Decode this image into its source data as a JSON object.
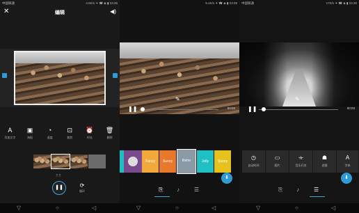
{
  "panels": [
    {
      "status": {
        "carrier": "中国联通",
        "right": "4.6K/s ✦ ☎ ◈ ▮ 23:26"
      },
      "header": {
        "title": "编辑"
      },
      "tools": [
        {
          "icon": "text-icon",
          "glyph": "A",
          "label": "添加文字"
        },
        {
          "icon": "image-icon",
          "glyph": "▣",
          "label": "海报"
        },
        {
          "icon": "speed-icon",
          "glyph": "◔",
          "label": "速度"
        },
        {
          "icon": "crop-icon",
          "glyph": "⊡",
          "label": "裁剪"
        },
        {
          "icon": "alarm-icon",
          "glyph": "⏰",
          "label": "时长"
        },
        {
          "icon": "delete-icon",
          "glyph": "🗑",
          "label": "删除"
        }
      ],
      "repeat": {
        "label": "循环"
      }
    },
    {
      "status": {
        "carrier": "",
        "right": "5.4K/s ✦ ☎ ◈ ▮ 23:29"
      },
      "player": {
        "time": "00:03"
      },
      "tiles": [
        "",
        "Fancy",
        "Sunny",
        "Retro",
        "Jolly",
        "Sunny"
      ]
    },
    {
      "status": {
        "carrier": "中国联通",
        "right": "17K/s ✦ ☎ ◈ ▮ 23:30"
      },
      "player": {
        "time": "00:03"
      },
      "options": [
        {
          "icon": "clock-icon",
          "glyph": "◷",
          "label": "自动时间"
        },
        {
          "icon": "picture-icon",
          "glyph": "▭",
          "label": "图片"
        },
        {
          "icon": "audio-icon",
          "glyph": "⟛",
          "label": "音乐开关"
        },
        {
          "icon": "filter-icon",
          "glyph": "☗",
          "label": "滤镜"
        },
        {
          "icon": "font-icon",
          "glyph": "A",
          "label": "字体"
        }
      ]
    }
  ],
  "colors": {
    "accent": "#2e9bd6",
    "teal": "#1fc0c4",
    "orange": "#f2a93b"
  }
}
